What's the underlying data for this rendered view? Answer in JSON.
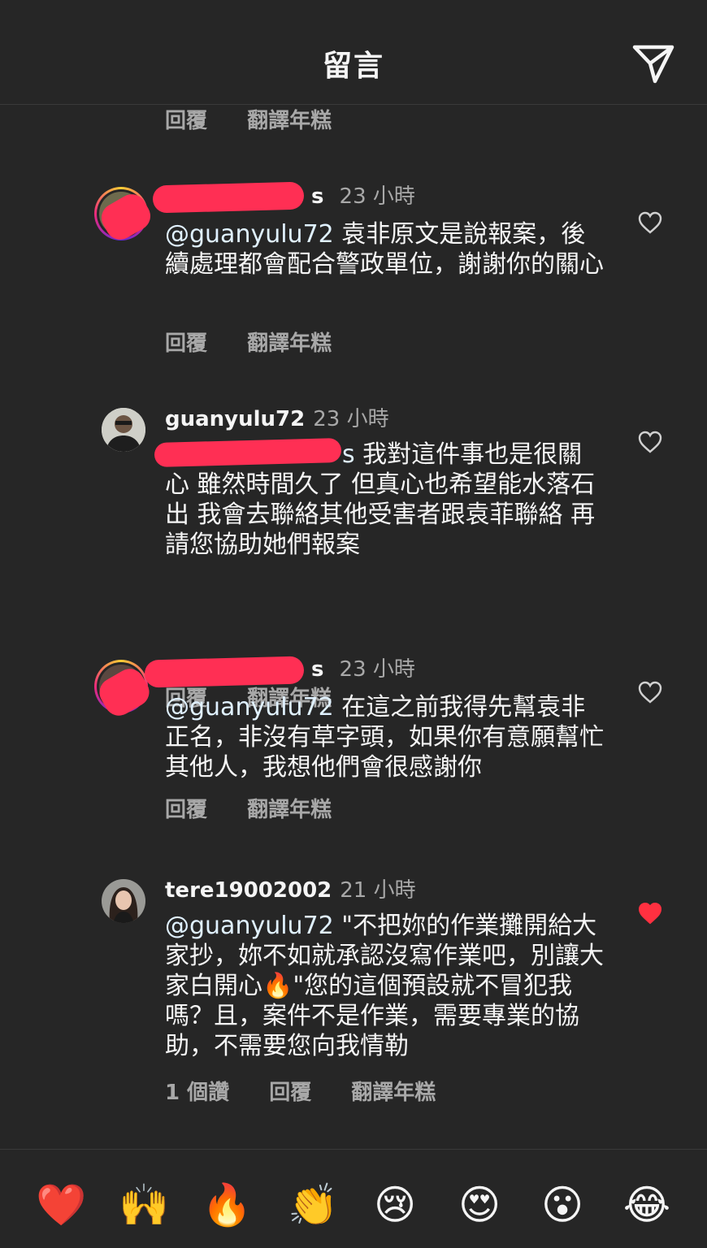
{
  "header": {
    "title": "留言"
  },
  "top_actions": {
    "reply": "回覆",
    "translate": "翻譯年糕"
  },
  "comments": [
    {
      "username_suffix": "s",
      "time": "23 小時",
      "mention": "@guanyulu72",
      "text": " 袁非原文是說報案，後續處理都會配合警政單位，謝謝你的關心",
      "reply": "回覆",
      "translate": "翻譯年糕",
      "liked": false
    },
    {
      "username": "guanyulu72",
      "time": "23 小時",
      "mention_suffix": "s",
      "text": " 我對這件事也是很關心 雖然時間久了 但真心也希望能水落石出 我會去聯絡其他受害者跟袁菲聯絡 再請您協助她們報案",
      "reply": "回覆",
      "translate": "翻譯年糕",
      "liked": false
    },
    {
      "username_suffix": "s",
      "time": "23 小時",
      "mention": "@guanyulu72",
      "text": " 在這之前我得先幫袁非正名，非沒有草字頭，如果你有意願幫忙其他人，我想他們會很感謝你",
      "reply": "回覆",
      "translate": "翻譯年糕",
      "liked": false
    },
    {
      "username": "tere19002002",
      "time": "21 小時",
      "mention": "@guanyulu72",
      "text_a": " \"不把妳的作業攤開給大家抄，妳不如就承認沒寫作業吧，別讓大家白開心",
      "emoji": "🔥",
      "text_b": "\"您的這個預設就不冒犯我嗎？且，案件不是作業，需要專業的協助，不需要您向我情勒",
      "likes": "1 個讚",
      "reply": "回覆",
      "translate": "翻譯年糕",
      "liked": true
    }
  ],
  "emoji_bar": [
    "❤️",
    "🙌",
    "🔥",
    "👏",
    "😢",
    "😍",
    "😮",
    "😂"
  ],
  "colors": {
    "background": "#262626",
    "like_red": "#ff3040",
    "secondary": "#a8a8a8"
  }
}
